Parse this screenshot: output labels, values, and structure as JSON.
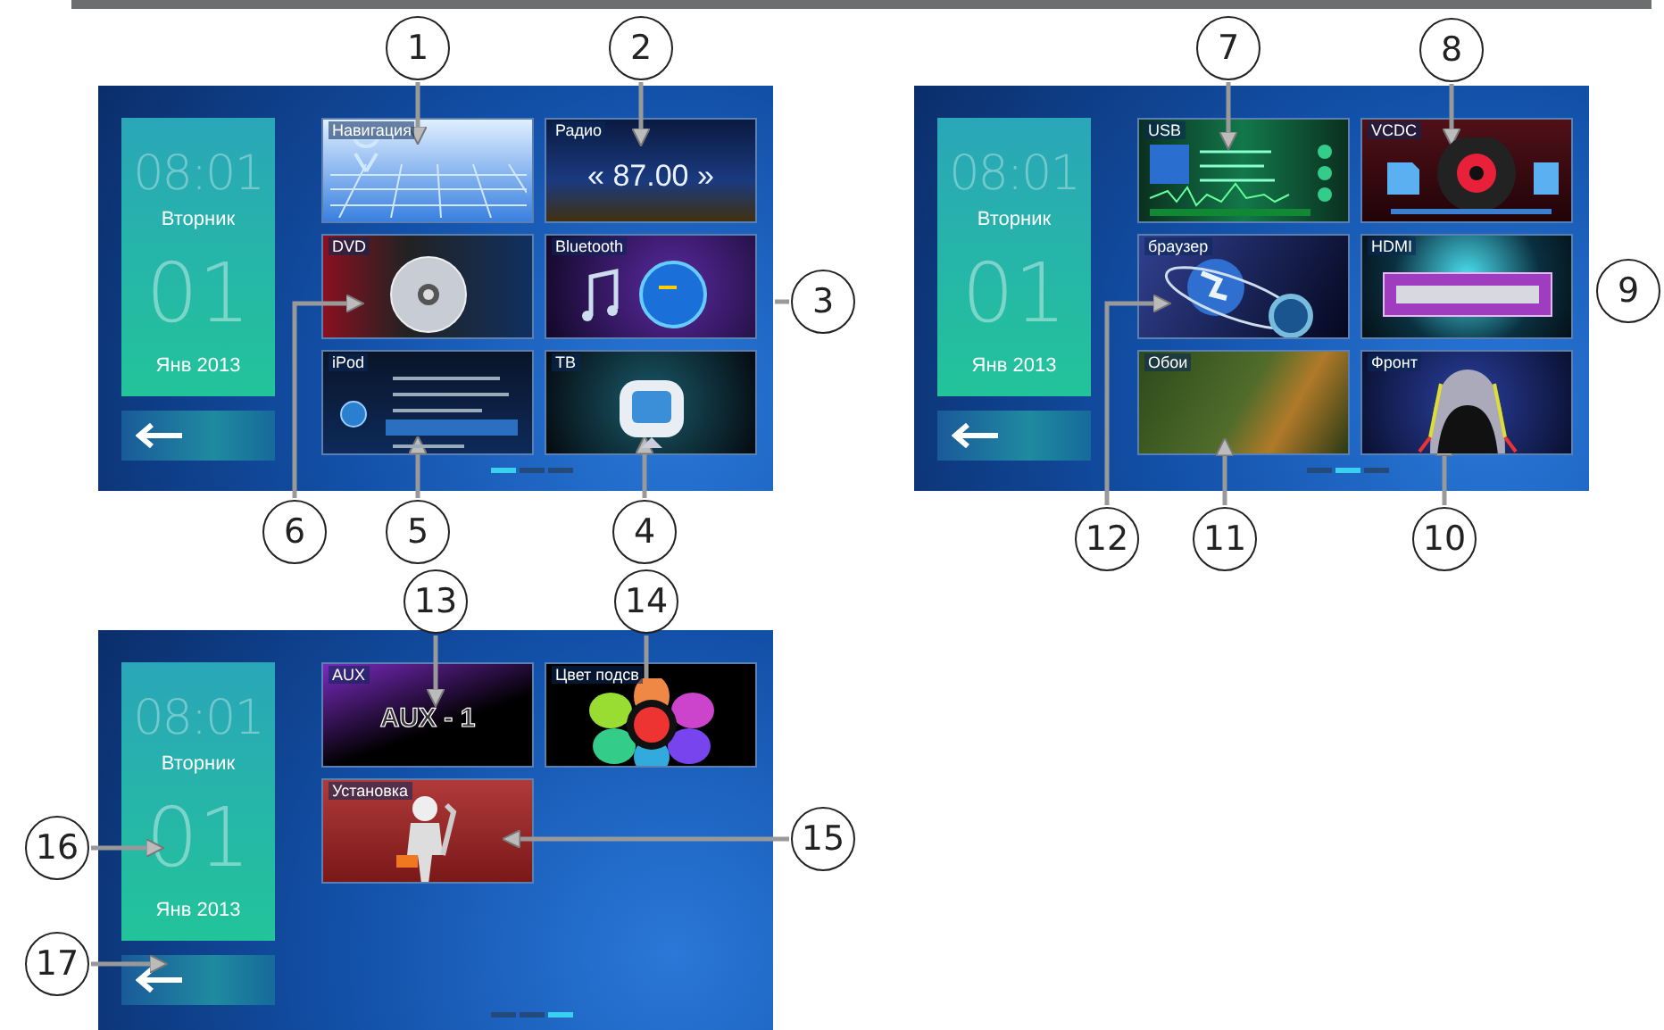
{
  "screens": [
    {
      "clock": {
        "time": "08:01",
        "weekday": "Вторник",
        "day": "01",
        "month_year": "Янв 2013"
      },
      "tiles": [
        {
          "kind": "navigation",
          "label": "Навигация"
        },
        {
          "kind": "radio",
          "label": "Радио",
          "frequency": "« 87.00 »"
        },
        {
          "kind": "dvd",
          "label": "DVD"
        },
        {
          "kind": "bluetooth",
          "label": "Bluetooth"
        },
        {
          "kind": "ipod",
          "label": "iPod"
        },
        {
          "kind": "tv",
          "label": "ТВ"
        }
      ],
      "page_dots": [
        {
          "selected": true
        },
        {
          "selected": false
        },
        {
          "selected": false
        }
      ]
    },
    {
      "clock": {
        "time": "08:01",
        "weekday": "Вторник",
        "day": "01",
        "month_year": "Янв 2013"
      },
      "tiles": [
        {
          "kind": "usb",
          "label": "USB"
        },
        {
          "kind": "vcdc",
          "label": "VCDC"
        },
        {
          "kind": "browser",
          "label": "браузер"
        },
        {
          "kind": "hdmi",
          "label": "HDMI"
        },
        {
          "kind": "wallpaper",
          "label": "Обои"
        },
        {
          "kind": "camera",
          "label": "Фронт"
        }
      ],
      "page_dots": [
        {
          "selected": false
        },
        {
          "selected": true
        },
        {
          "selected": false
        }
      ]
    },
    {
      "clock": {
        "time": "08:01",
        "weekday": "Вторник",
        "day": "01",
        "month_year": "Янв 2013"
      },
      "tiles": [
        {
          "kind": "aux",
          "label": "AUX",
          "display": "AUX - 1"
        },
        {
          "kind": "color",
          "label": "Цвет подсв"
        },
        {
          "kind": "settings",
          "label": "Установка"
        }
      ],
      "page_dots": [
        {
          "selected": false
        },
        {
          "selected": false
        },
        {
          "selected": true
        }
      ]
    }
  ],
  "callouts": [
    {
      "number": "1"
    },
    {
      "number": "2"
    },
    {
      "number": "7"
    },
    {
      "number": "8"
    },
    {
      "number": "3"
    },
    {
      "number": "9"
    },
    {
      "number": "6"
    },
    {
      "number": "5"
    },
    {
      "number": "4"
    },
    {
      "number": "12"
    },
    {
      "number": "11"
    },
    {
      "number": "10"
    },
    {
      "number": "13"
    },
    {
      "number": "14"
    },
    {
      "number": "16"
    },
    {
      "number": "15"
    },
    {
      "number": "17"
    }
  ]
}
